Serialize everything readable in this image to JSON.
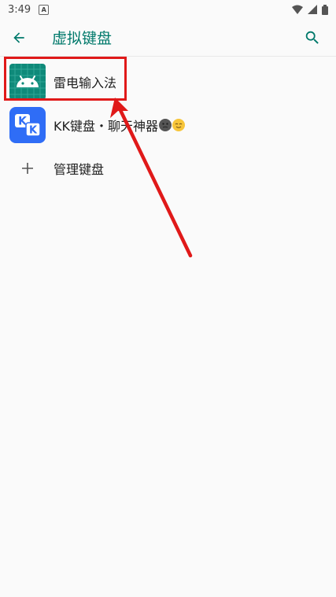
{
  "status_bar": {
    "time": "3:49",
    "notif_letter": "A"
  },
  "app_bar": {
    "title": "虚拟键盘"
  },
  "keyboards": [
    {
      "name": "雷电输入法"
    },
    {
      "name": "KK键盘・聊天神器"
    }
  ],
  "manage": {
    "label": "管理键盘"
  },
  "colors": {
    "accent": "#00796b",
    "highlight": "#e01919",
    "leidian_icon_bg": "#0f8a7a",
    "kk_icon_bg": "#2f6df6"
  },
  "icons": {
    "back": "arrow-back-icon",
    "search": "search-icon",
    "add": "plus-icon",
    "leidian": "android-icon",
    "kk": "kk-keyboard-icon"
  }
}
